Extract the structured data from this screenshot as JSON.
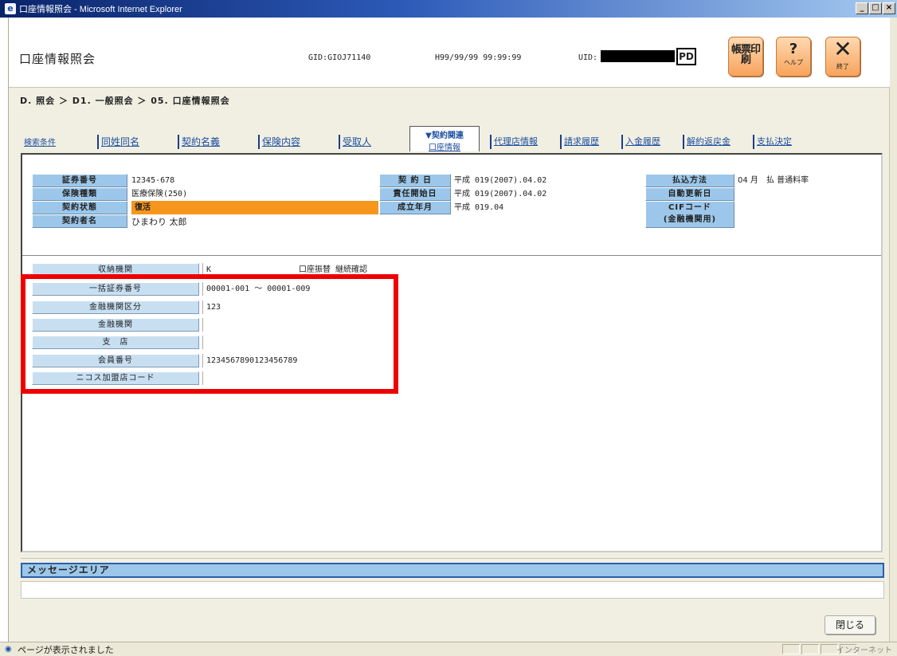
{
  "window": {
    "title": "口座情報照会 - Microsoft Internet Explorer",
    "controls": [
      "_",
      "□",
      "×"
    ]
  },
  "header": {
    "app_title": "口座情報照会",
    "gid": "GID:GIOJ71140",
    "datetime": "H99/99/99 99:99:99",
    "uid_label": "UID:",
    "pd_label": "PD",
    "print_label": "帳票印刷",
    "help_glyph": "?",
    "help_label": "ヘルプ",
    "exit_glyph": "✕",
    "exit_label": "終了"
  },
  "breadcrumb": "D. 照会 ＞ D1. 一般照会 ＞ 05. 口座情報照会",
  "tabs": {
    "search_condition": "検索条件",
    "same_name": "同姓同名",
    "contract_name": "契約名義",
    "insurance_content": "保険内容",
    "recipient": "受取人",
    "active_group": "▼契約関連",
    "active_label": "口座情報",
    "agency": "代理店情報",
    "billing_history": "請求履歴",
    "deposit_history": "入金履歴",
    "cancellation_refund": "解約返戻金",
    "payment_decision": "支払決定"
  },
  "contract": {
    "policy_no_label": "証券番号",
    "policy_no": "12345-678",
    "insurance_type_label": "保険種類",
    "insurance_type": "医療保険(250)",
    "status_label": "契約状態",
    "status": "復活",
    "holder_label": "契約者名",
    "holder": "ひまわり 太郎",
    "contract_date_label": "契 約 日",
    "contract_date": "平成 019(2007).04.02",
    "liability_start_label": "責任開始日",
    "liability_start": "平成 019(2007).04.02",
    "established_label": "成立年月",
    "established": "平成 019.04",
    "payment_method_label": "払込方法",
    "payment_method": "04 月　払 普通料率",
    "auto_renewal_label": "自動更新日",
    "auto_renewal": "",
    "cif_label": "CIFコード\n(金融機関用)",
    "cif": ""
  },
  "account": {
    "rows": [
      {
        "label": "収納機関",
        "value": "K　　　　　　　　　　　口座振替 継続確認"
      },
      {
        "label": "一括証券番号",
        "value": "00001-001 ～ 00001-009"
      },
      {
        "label": "金融機関区分",
        "value": "123"
      },
      {
        "label": "金融機関",
        "value": ""
      },
      {
        "label": "支　店",
        "value": ""
      },
      {
        "label": "会員番号",
        "value": "1234567890123456789"
      },
      {
        "label": "ニコス加盟店コード",
        "value": ""
      }
    ]
  },
  "message_area": {
    "header": "メッセージエリア",
    "body": ""
  },
  "close_button": "閉じる",
  "statusbar": {
    "text": "ページが表示されました",
    "zone": "インターネット"
  },
  "colors": {
    "label_blue": "#9cc7ea",
    "status_orange": "#f7961d",
    "highlight_red": "#ef0000",
    "link_blue": "#1d4fa0"
  }
}
